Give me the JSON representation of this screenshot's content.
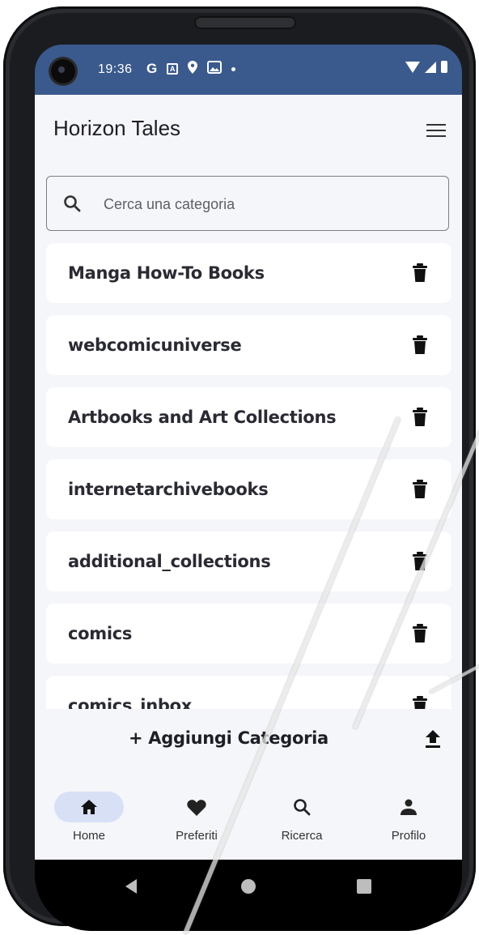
{
  "status_bar": {
    "time": "19:36",
    "icons": [
      "google-g-icon",
      "a-box-icon",
      "location-icon",
      "image-icon",
      "dot-icon"
    ],
    "right_icons": [
      "wifi-icon",
      "signal-icon",
      "battery-icon"
    ]
  },
  "app": {
    "title": "Horizon Tales",
    "search": {
      "placeholder": "Cerca una categoria",
      "value": ""
    },
    "categories": [
      {
        "label": "Manga How-To Books"
      },
      {
        "label": "webcomicuniverse"
      },
      {
        "label": "Artbooks and Art Collections"
      },
      {
        "label": "internetarchivebooks"
      },
      {
        "label": "additional_collections"
      },
      {
        "label": "comics"
      },
      {
        "label": "comics_inbox"
      }
    ],
    "add_category_label": "+ Aggiungi Categoria"
  },
  "bottom_nav": {
    "items": [
      {
        "label": "Home",
        "icon": "home-icon",
        "active": true
      },
      {
        "label": "Preferiti",
        "icon": "heart-icon",
        "active": false
      },
      {
        "label": "Ricerca",
        "icon": "search-icon",
        "active": false
      },
      {
        "label": "Profilo",
        "icon": "person-icon",
        "active": false
      }
    ]
  },
  "colors": {
    "status_bar": "#3a5a8e",
    "background": "#f5f6fa",
    "active_nav_pill": "#d7e0f5",
    "text": "#1d1d22"
  }
}
